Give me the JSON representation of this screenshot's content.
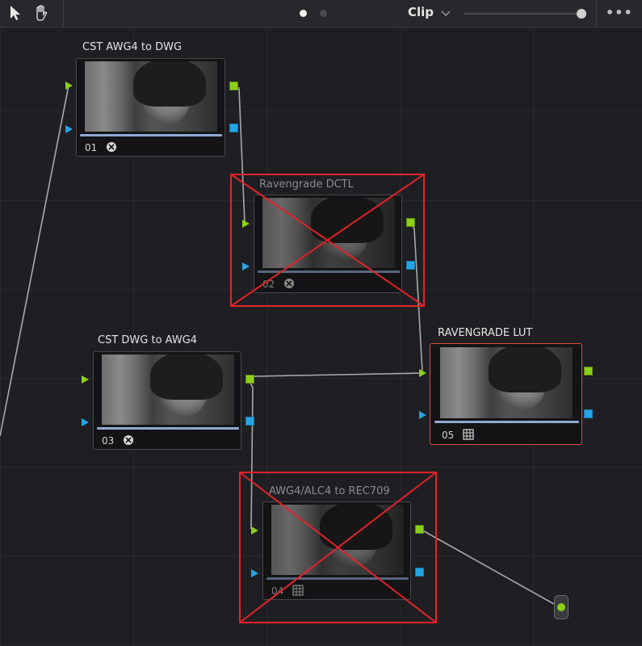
{
  "toolbar": {
    "mode_label": "Clip",
    "icons": [
      "pointer-icon",
      "hand-icon",
      "page-dot-active",
      "page-dot-inactive",
      "chevron-down-icon",
      "more-icon"
    ],
    "more_label": "•••"
  },
  "nodes": [
    {
      "id": "01",
      "label": "CST AWG4 to DWG",
      "icon": "color-space-icon",
      "state": "normal"
    },
    {
      "id": "02",
      "label": "Ravengrade DCTL",
      "icon": "color-space-icon",
      "state": "disabled-crossed-out"
    },
    {
      "id": "03",
      "label": "CST DWG to AWG4",
      "icon": "color-space-icon",
      "state": "normal"
    },
    {
      "id": "04",
      "label": "AWG4/ALC4 to REC709",
      "icon": "lut-icon",
      "state": "disabled-crossed-out"
    },
    {
      "id": "05",
      "label": "RAVENGRADE LUT",
      "icon": "lut-icon",
      "state": "selected"
    }
  ],
  "colors": {
    "rgb_port": "#8ccf1a",
    "alpha_port": "#26a5e6",
    "selected_border": "#d9503f",
    "cross_out": "#e2232a",
    "background": "#1f1f23"
  }
}
